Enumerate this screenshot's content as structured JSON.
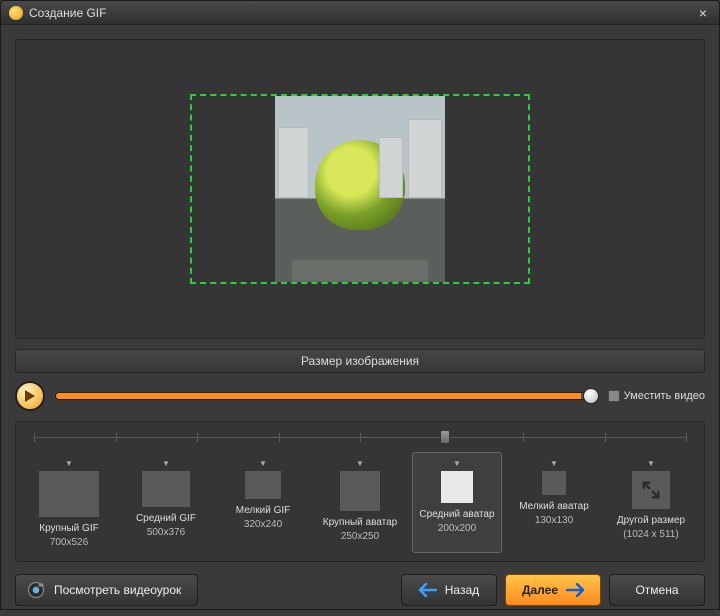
{
  "window": {
    "title": "Создание GIF"
  },
  "section": {
    "image_size": "Размер изображения"
  },
  "fit": {
    "label": "Уместить видео"
  },
  "presets": [
    {
      "label": "Крупный GIF",
      "dims": "700x526",
      "thumbClass": "t-60"
    },
    {
      "label": "Средний GIF",
      "dims": "500x376",
      "thumbClass": "t-48"
    },
    {
      "label": "Мелкий GIF",
      "dims": "320x240",
      "thumbClass": "t-36"
    },
    {
      "label": "Крупный аватар",
      "dims": "250x250",
      "thumbClass": "t-40"
    },
    {
      "label": "Средний аватар",
      "dims": "200x200",
      "thumbClass": "t-32",
      "selected": true,
      "white": true
    },
    {
      "label": "Мелкий аватар",
      "dims": "130x130",
      "thumbClass": "t-24"
    },
    {
      "label": "Другой размер",
      "dims": "(1024 x 511)",
      "thumbClass": "t-38",
      "icon": true
    }
  ],
  "footer": {
    "video_tutorial": "Посмотреть видеоурок",
    "back": "Назад",
    "next": "Далее",
    "cancel": "Отмена"
  }
}
